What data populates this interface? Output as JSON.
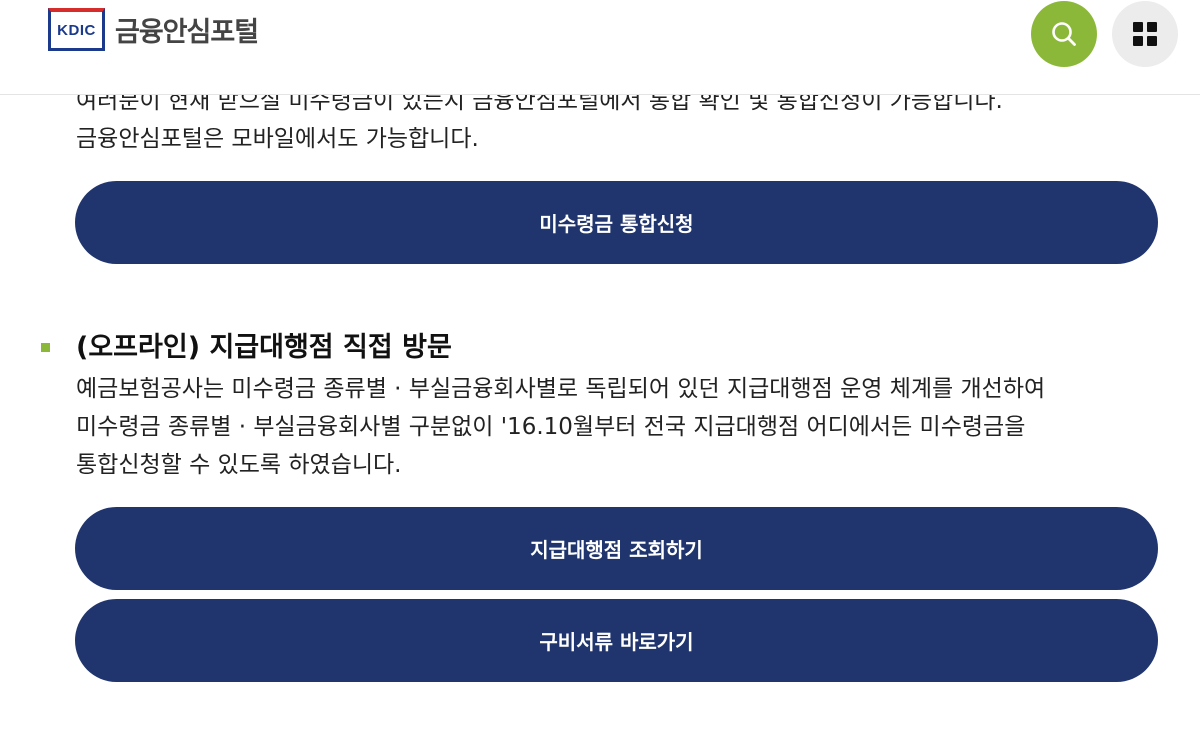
{
  "header": {
    "logo_badge": "KDIC",
    "logo_title": "금융안심포털",
    "search_icon": "search-icon",
    "menu_icon": "grid-menu-icon",
    "accent_color": "#8cb83a",
    "brand_blue": "#1b3a8c",
    "brand_red": "#d62c2c"
  },
  "intro": {
    "line1": "여러분이 현재 받으실 미수령금이 있는지 금융안심포털에서 통합 확인 및 통합신청이 가능합니다.",
    "line2": "금융안심포털은 모바일에서도 가능합니다."
  },
  "buttons": {
    "apply_label": "미수령금 통합신청",
    "agent_lookup_label": "지급대행점 조회하기",
    "documents_label": "구비서류 바로가기",
    "button_color": "#20356d"
  },
  "offline_section": {
    "title": "(오프라인) 지급대행점 직접 방문",
    "desc_line1": "예금보험공사는 미수령금 종류별 · 부실금융회사별로 독립되어 있던 지급대행점 운영 체계를 개선하여",
    "desc_line2": "미수령금 종류별 · 부실금융회사별 구분없이 '16.10월부터 전국 지급대행점 어디에서든 미수령금을",
    "desc_line3": "통합신청할 수 있도록 하였습니다."
  }
}
